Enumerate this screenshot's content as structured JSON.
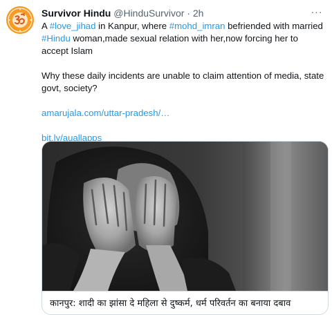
{
  "tweet": {
    "author_name": "Survivor Hindu",
    "handle": "@HinduSurvivor",
    "separator": "·",
    "time": "2h",
    "more_label": "···",
    "line1": {
      "t1": "A ",
      "tag1": "#love_jihad",
      "t2": " in Kanpur, where ",
      "tag2": "#mohd_imran",
      "t3": " befriended with married"
    },
    "line2": {
      "tag3": "#Hindu",
      "t4": " woman,made sexual relation with her,now forcing her to accept Islam"
    },
    "paragraph2": "Why these daily incidents are unable to claim attention of media, state govt, society?",
    "link1": "amarujala.com/uttar-pradesh/…",
    "link2": "bit.ly/auallapps"
  },
  "card": {
    "caption": "कानपुर: शादी का झांसा दे महिला से दुष्कर्म, धर्म परिवर्तन का बनाया दबाव"
  },
  "colors": {
    "text": "#0f1419",
    "secondary": "#536471",
    "link": "#1d9bf0",
    "border": "#cfd9de",
    "avatar_bg": "#f79b24"
  },
  "icons": {
    "avatar": "om-emblem-avatar",
    "more": "more-options-icon"
  }
}
